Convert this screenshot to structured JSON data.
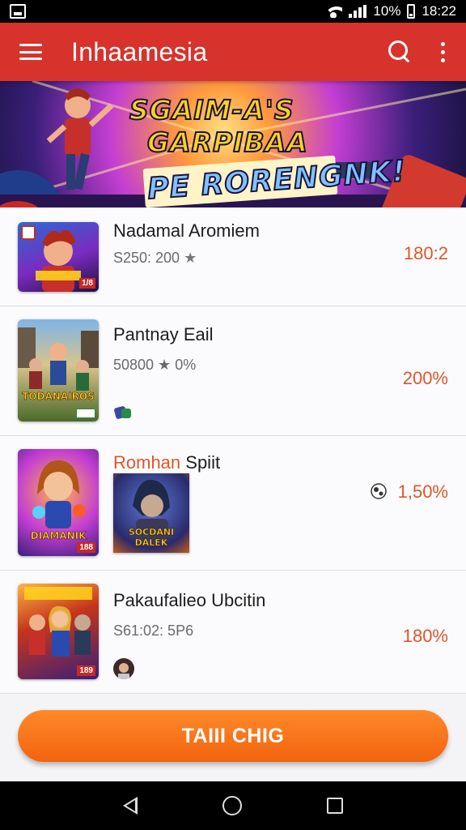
{
  "status_bar": {
    "battery": "10%",
    "time": "18:22"
  },
  "app_bar": {
    "title": "Inhaamesia"
  },
  "banner": {
    "line1": "SGAIM-A'S",
    "line2": "GARPIBAA",
    "line3": "PE RORENGNK!"
  },
  "items": [
    {
      "name": "Nadamal  Aromiem",
      "meta": "S250: 200",
      "percent": "180:2",
      "cover_caption": "",
      "cover_tag": "1/8"
    },
    {
      "name": "Pantnay Eail",
      "meta": "50800 ★ 0%",
      "percent": "200%",
      "cover_caption": "TODANAIROS",
      "cover_tag": ""
    },
    {
      "name_accent": "Romhan",
      "name_rest": " Spiit",
      "meta": "",
      "percent": "1,50%",
      "cover_caption": "DIAMANIK",
      "cover_tag": "188",
      "extra_caption": "SOCDANI DALEK"
    },
    {
      "name": "Pakaufalieo Ubcitin",
      "meta": "S61:02: 5P6",
      "percent": "180%",
      "cover_caption": "",
      "cover_tag": "189"
    }
  ],
  "cta": {
    "label": "TAIII CHIG"
  },
  "colors": {
    "app_bar": "#d7322b",
    "accent": "#e0552a",
    "cta": "#f2630e"
  }
}
